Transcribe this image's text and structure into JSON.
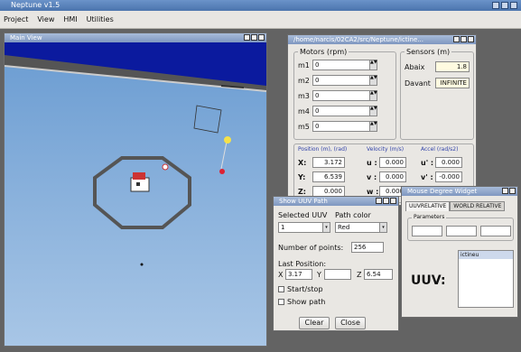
{
  "app": {
    "title": "Neptune v1.5"
  },
  "menu": [
    "Project",
    "View",
    "HMI",
    "Utilities"
  ],
  "main_view": {
    "title": "Main View"
  },
  "motors_window": {
    "title": "/home/narcis/02CA2/src/Neptune/ictine...",
    "motors_group": "Motors (rpm)",
    "motors": [
      {
        "label": "m1",
        "value": "0"
      },
      {
        "label": "m2",
        "value": "0"
      },
      {
        "label": "m3",
        "value": "0"
      },
      {
        "label": "m4",
        "value": "0"
      },
      {
        "label": "m5",
        "value": "0"
      }
    ],
    "sensors_group": "Sensors (m)",
    "sensors": [
      {
        "label": "Abaix",
        "value": "1.8"
      },
      {
        "label": "Davant",
        "value": "INFINITE"
      }
    ],
    "pos_headers": [
      "Position (m), (rad)",
      "Velocity (m/s)",
      "Accel (rad/s2)"
    ],
    "pos_rows": [
      {
        "p": "X:",
        "pv": "3.172",
        "v": "u :",
        "vv": "0.000",
        "a": "u' :",
        "av": "0.000"
      },
      {
        "p": "Y:",
        "pv": "6.539",
        "v": "v :",
        "vv": "0.000",
        "a": "v' :",
        "av": "-0.000"
      },
      {
        "p": "Z:",
        "pv": "0.000",
        "v": "w :",
        "vv": "0.000",
        "a": "",
        "av": ""
      }
    ]
  },
  "uuv_path": {
    "title": "Show UUV Path",
    "selected_label": "Selected UUV",
    "color_label": "Path color",
    "selected_value": "1",
    "color_value": "Red",
    "points_label": "Number of points:",
    "points_value": "256",
    "last_pos_label": "Last Position:",
    "x_label": "X",
    "x_value": "3.17",
    "y_label": "Y",
    "y_value": "",
    "z_label": "Z",
    "z_value": "6.54",
    "start_stop": "Start/stop",
    "show_path": "Show path",
    "clear": "Clear",
    "close": "Close"
  },
  "mouse_widget": {
    "title": "Mouse Degree Widget",
    "tabs": [
      "UUVRELATIVE",
      "WORLD RELATIVE"
    ],
    "params_label": "Parameters",
    "uuv_label": "UUV:",
    "list_item": "ictineu"
  },
  "colors": {
    "titlebar": "#4b74ad",
    "sea": "#7fa9d6",
    "sky": "#0b1a9e"
  }
}
